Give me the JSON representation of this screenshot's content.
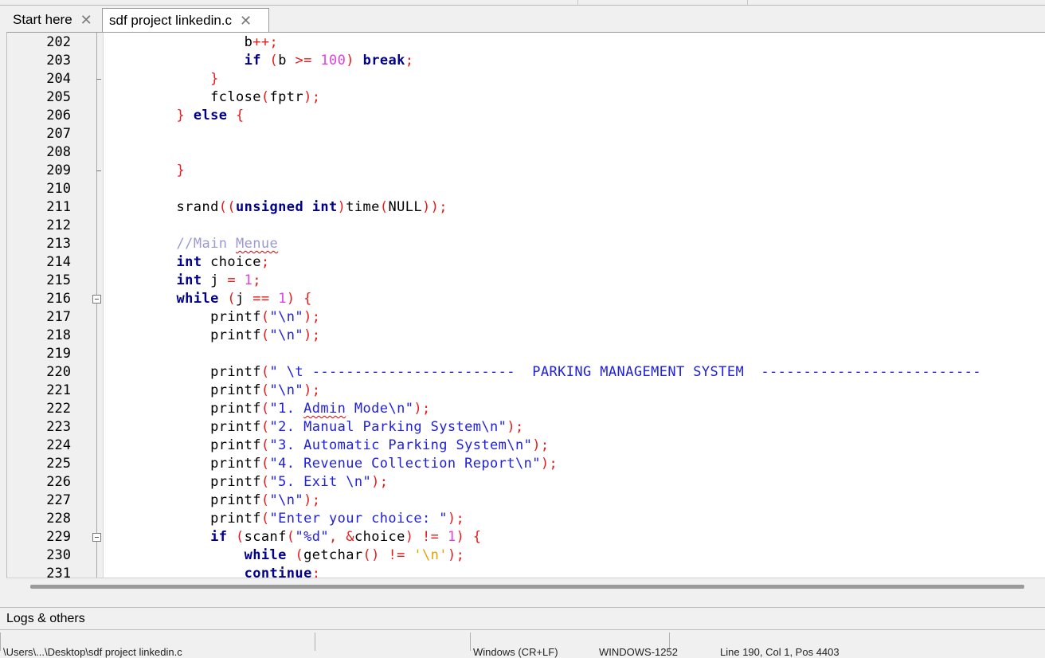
{
  "tabs": [
    {
      "label": "Start here",
      "active": false
    },
    {
      "label": "sdf project linkedin.c",
      "active": true
    }
  ],
  "close_glyph": "✕",
  "panel": {
    "logs_label": "Logs & others"
  },
  "editor": {
    "lines": [
      {
        "num": "202",
        "tokens": [
          [
            "plain",
            "            b"
          ],
          [
            "op",
            "++;"
          ]
        ]
      },
      {
        "num": "203",
        "tokens": [
          [
            "plain",
            "            "
          ],
          [
            "kw",
            "if"
          ],
          [
            "plain",
            " "
          ],
          [
            "op",
            "("
          ],
          [
            "plain",
            "b "
          ],
          [
            "op",
            ">="
          ],
          [
            "plain",
            " "
          ],
          [
            "num",
            "100"
          ],
          [
            "op",
            ")"
          ],
          [
            "plain",
            " "
          ],
          [
            "kw",
            "break"
          ],
          [
            "op",
            ";"
          ]
        ]
      },
      {
        "num": "204",
        "tokens": [
          [
            "plain",
            "        "
          ],
          [
            "op",
            "}"
          ]
        ]
      },
      {
        "num": "205",
        "tokens": [
          [
            "plain",
            "        fclose"
          ],
          [
            "op",
            "("
          ],
          [
            "plain",
            "fptr"
          ],
          [
            "op",
            ");"
          ]
        ]
      },
      {
        "num": "206",
        "tokens": [
          [
            "plain",
            "    "
          ],
          [
            "op",
            "}"
          ],
          [
            "plain",
            " "
          ],
          [
            "kw",
            "else"
          ],
          [
            "plain",
            " "
          ],
          [
            "op",
            "{"
          ]
        ]
      },
      {
        "num": "207",
        "tokens": []
      },
      {
        "num": "208",
        "tokens": []
      },
      {
        "num": "209",
        "tokens": [
          [
            "plain",
            "    "
          ],
          [
            "op",
            "}"
          ]
        ]
      },
      {
        "num": "210",
        "tokens": []
      },
      {
        "num": "211",
        "tokens": [
          [
            "plain",
            "    srand"
          ],
          [
            "op",
            "(("
          ],
          [
            "kw",
            "unsigned int"
          ],
          [
            "op",
            ")"
          ],
          [
            "plain",
            "time"
          ],
          [
            "op",
            "("
          ],
          [
            "plain",
            "NULL"
          ],
          [
            "op",
            "));"
          ]
        ]
      },
      {
        "num": "212",
        "tokens": []
      },
      {
        "num": "213",
        "tokens": [
          [
            "plain",
            "    "
          ],
          [
            "cmt",
            "//Main "
          ],
          [
            "cmt-sq",
            "Menue"
          ]
        ]
      },
      {
        "num": "214",
        "tokens": [
          [
            "plain",
            "    "
          ],
          [
            "kw",
            "int"
          ],
          [
            "plain",
            " choice"
          ],
          [
            "op",
            ";"
          ]
        ]
      },
      {
        "num": "215",
        "tokens": [
          [
            "plain",
            "    "
          ],
          [
            "kw",
            "int"
          ],
          [
            "plain",
            " j "
          ],
          [
            "op",
            "="
          ],
          [
            "plain",
            " "
          ],
          [
            "num",
            "1"
          ],
          [
            "op",
            ";"
          ]
        ]
      },
      {
        "num": "216",
        "tokens": [
          [
            "plain",
            "    "
          ],
          [
            "kw",
            "while"
          ],
          [
            "plain",
            " "
          ],
          [
            "op",
            "("
          ],
          [
            "plain",
            "j "
          ],
          [
            "op",
            "=="
          ],
          [
            "plain",
            " "
          ],
          [
            "num",
            "1"
          ],
          [
            "op",
            ")"
          ],
          [
            "plain",
            " "
          ],
          [
            "op",
            "{"
          ]
        ]
      },
      {
        "num": "217",
        "tokens": [
          [
            "plain",
            "        printf"
          ],
          [
            "op",
            "("
          ],
          [
            "str",
            "\"\\n\""
          ],
          [
            "op",
            ");"
          ]
        ]
      },
      {
        "num": "218",
        "tokens": [
          [
            "plain",
            "        printf"
          ],
          [
            "op",
            "("
          ],
          [
            "str",
            "\"\\n\""
          ],
          [
            "op",
            ");"
          ]
        ]
      },
      {
        "num": "219",
        "tokens": []
      },
      {
        "num": "220",
        "tokens": [
          [
            "plain",
            "        printf"
          ],
          [
            "op",
            "("
          ],
          [
            "str",
            "\" \\t ------------------------  PARKING MANAGEMENT SYSTEM  --------------------------"
          ]
        ]
      },
      {
        "num": "221",
        "tokens": [
          [
            "plain",
            "        printf"
          ],
          [
            "op",
            "("
          ],
          [
            "str",
            "\"\\n\""
          ],
          [
            "op",
            ");"
          ]
        ]
      },
      {
        "num": "222",
        "tokens": [
          [
            "plain",
            "        printf"
          ],
          [
            "op",
            "("
          ],
          [
            "str",
            "\"1. "
          ],
          [
            "str-sq",
            "Admin"
          ],
          [
            "str",
            " Mode\\n\""
          ],
          [
            "op",
            ");"
          ]
        ]
      },
      {
        "num": "223",
        "tokens": [
          [
            "plain",
            "        printf"
          ],
          [
            "op",
            "("
          ],
          [
            "str",
            "\"2. Manual Parking System\\n\""
          ],
          [
            "op",
            ");"
          ]
        ]
      },
      {
        "num": "224",
        "tokens": [
          [
            "plain",
            "        printf"
          ],
          [
            "op",
            "("
          ],
          [
            "str",
            "\"3. Automatic Parking System\\n\""
          ],
          [
            "op",
            ");"
          ]
        ]
      },
      {
        "num": "225",
        "tokens": [
          [
            "plain",
            "        printf"
          ],
          [
            "op",
            "("
          ],
          [
            "str",
            "\"4. Revenue Collection Report\\n\""
          ],
          [
            "op",
            ");"
          ]
        ]
      },
      {
        "num": "226",
        "tokens": [
          [
            "plain",
            "        printf"
          ],
          [
            "op",
            "("
          ],
          [
            "str",
            "\"5. Exit \\n\""
          ],
          [
            "op",
            ");"
          ]
        ]
      },
      {
        "num": "227",
        "tokens": [
          [
            "plain",
            "        printf"
          ],
          [
            "op",
            "("
          ],
          [
            "str",
            "\"\\n\""
          ],
          [
            "op",
            ");"
          ]
        ]
      },
      {
        "num": "228",
        "tokens": [
          [
            "plain",
            "        printf"
          ],
          [
            "op",
            "("
          ],
          [
            "str",
            "\"Enter your choice: \""
          ],
          [
            "op",
            ");"
          ]
        ]
      },
      {
        "num": "229",
        "tokens": [
          [
            "plain",
            "        "
          ],
          [
            "kw",
            "if"
          ],
          [
            "plain",
            " "
          ],
          [
            "op",
            "("
          ],
          [
            "plain",
            "scanf"
          ],
          [
            "op",
            "("
          ],
          [
            "str",
            "\"%d\""
          ],
          [
            "op",
            ","
          ],
          [
            "plain",
            " "
          ],
          [
            "op",
            "&"
          ],
          [
            "plain",
            "choice"
          ],
          [
            "op",
            ")"
          ],
          [
            "plain",
            " "
          ],
          [
            "op",
            "!="
          ],
          [
            "plain",
            " "
          ],
          [
            "num",
            "1"
          ],
          [
            "op",
            ")"
          ],
          [
            "plain",
            " "
          ],
          [
            "op",
            "{"
          ]
        ]
      },
      {
        "num": "230",
        "tokens": [
          [
            "plain",
            "            "
          ],
          [
            "kw",
            "while"
          ],
          [
            "plain",
            " "
          ],
          [
            "op",
            "("
          ],
          [
            "plain",
            "getchar"
          ],
          [
            "op",
            "()"
          ],
          [
            "plain",
            " "
          ],
          [
            "op",
            "!="
          ],
          [
            "plain",
            " "
          ],
          [
            "chr",
            "'\\n'"
          ],
          [
            "op",
            ");"
          ]
        ]
      },
      {
        "num": "231",
        "tokens": [
          [
            "plain",
            "            "
          ],
          [
            "kw",
            "continue"
          ],
          [
            "op",
            ";"
          ]
        ]
      }
    ],
    "fold_markers": [
      "216",
      "229"
    ],
    "fold_ticks": [
      "204",
      "209"
    ]
  },
  "statusbar": {
    "items": [
      "\\Users\\...\\Desktop\\sdf project linkedin.c",
      "Windows (CR+LF)",
      "WINDOWS-1252",
      "Line 190, Col 1, Pos 4403"
    ]
  },
  "colors": {
    "keyword": "#00008b",
    "operator": "#e81a1a",
    "number": "#e040e0",
    "string": "#2020e0",
    "comment": "#9a9ad2",
    "char": "#e6a000"
  },
  "icons": [
    "close-icon",
    "fold-collapse-icon"
  ]
}
